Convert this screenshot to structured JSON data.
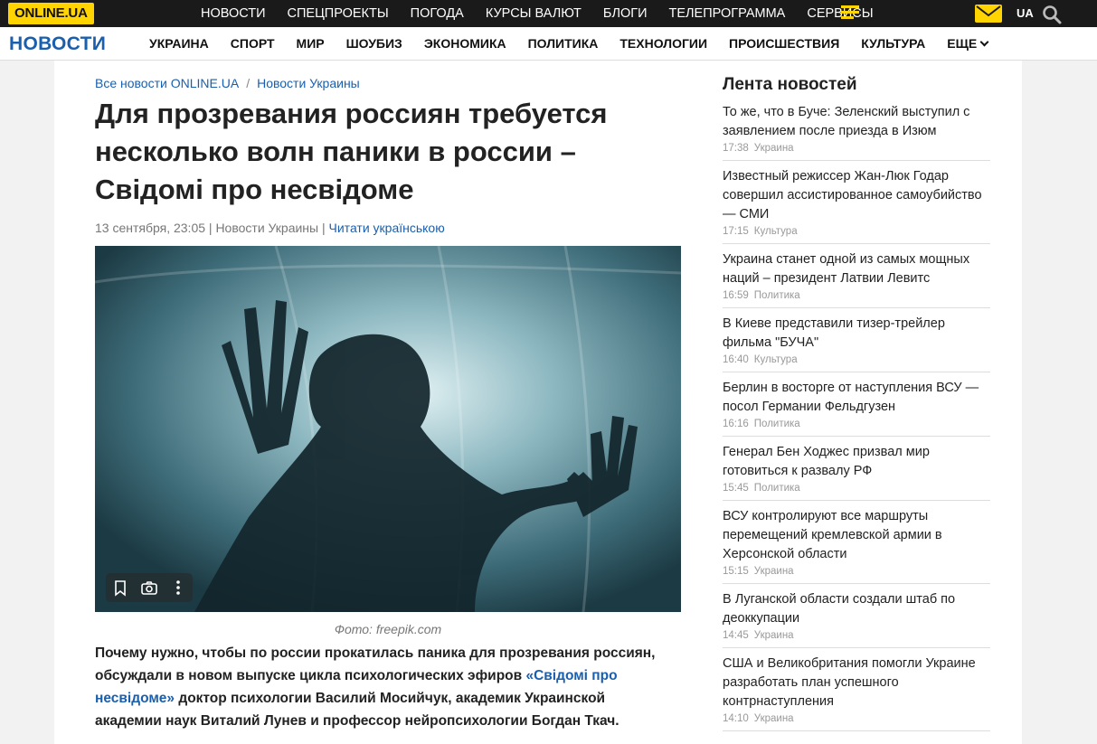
{
  "topbar": {
    "logo": "ONLINE.UA",
    "nav": [
      "НОВОСТИ",
      "СПЕЦПРОЕКТЫ",
      "ПОГОДА",
      "КУРСЫ ВАЛЮТ",
      "БЛОГИ",
      "ТЕЛЕПРОГРАММА",
      "СЕРВИСЫ"
    ],
    "lang": "UA",
    "icons": [
      "menu-icon",
      "mail-icon",
      "search-icon"
    ],
    "accent": "#ffd400"
  },
  "secbar": {
    "section_title": "НОВОСТИ",
    "categories": [
      "УКРАИНА",
      "СПОРТ",
      "МИР",
      "ШОУБИЗ",
      "ЭКОНОМИКА",
      "ПОЛИТИКА",
      "ТЕХНОЛОГИИ",
      "ПРОИСШЕСТВИЯ",
      "КУЛЬТУРА",
      "ЕЩЕ"
    ]
  },
  "article": {
    "breadcrumbs": [
      "Все новости ONLINE.UA",
      "Новости Украины"
    ],
    "title": "Для прозревания россиян требуется несколько волн паники в россии – Свідомі про несвідоме",
    "date": "13 сентября, 23:05",
    "category": "Новости Украины",
    "translate_link": "Читати українською",
    "photo_caption": "Фото: freepik.com",
    "lead_before": "Почему нужно, чтобы по россии прокатилась паника для прозревания россиян, обсуждали в новом выпуске цикла психологических эфиров ",
    "lead_link": "«Свідомі про несвідоме»",
    "lead_after": " доктор психологии Василий Мосийчук, академик Украинской академии наук Виталий Лунев и профессор нейропсихологии Богдан Ткач.",
    "link_color": "#1a5fad"
  },
  "feed": {
    "title": "Лента новостей",
    "items": [
      {
        "title": "То же, что в Буче: Зеленский выступил с заявлением после приезда в Изюм",
        "time": "17:38",
        "category": "Украина"
      },
      {
        "title": "Известный режиссер Жан-Люк Годар совершил ассистированное самоубийство — СМИ",
        "time": "17:15",
        "category": "Культура"
      },
      {
        "title": "Украина станет одной из самых мощных наций – президент Латвии Левитс",
        "time": "16:59",
        "category": "Политика"
      },
      {
        "title": "В Киеве представили тизер-трейлер фильма \"БУЧА\"",
        "time": "16:40",
        "category": "Культура"
      },
      {
        "title": "Берлин в восторге от наступления ВСУ — посол Германии Фельдгузен",
        "time": "16:16",
        "category": "Политика"
      },
      {
        "title": "Генерал Бен Ходжес призвал мир готовиться к развалу РФ",
        "time": "15:45",
        "category": "Политика"
      },
      {
        "title": "ВСУ контролируют все маршруты перемещений кремлевской армии в Херсонской области",
        "time": "15:15",
        "category": "Украина"
      },
      {
        "title": "В Луганской области создали штаб по деоккупации",
        "time": "14:45",
        "category": "Украина"
      },
      {
        "title": "США и Великобритания помогли Украине разработать план успешного контрнаступления",
        "time": "14:10",
        "category": "Украина"
      }
    ]
  }
}
